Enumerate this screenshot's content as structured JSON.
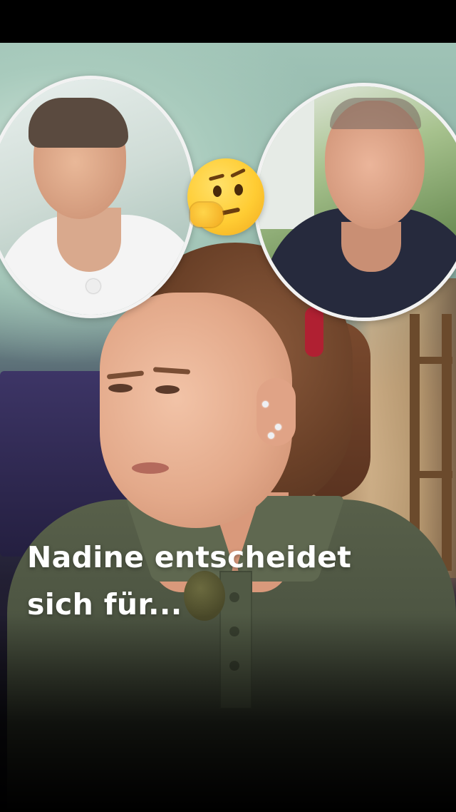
{
  "caption": {
    "line1": "Nadine entscheidet",
    "line2": "sich für..."
  },
  "overlays": {
    "left_portrait": "man-in-white-tshirt",
    "right_portrait": "man-in-navy-pullover",
    "emoji": "thinking-face-icon"
  },
  "colors": {
    "caption_text": "#ffffff",
    "circle_border": "#f2f2f2",
    "letterbox": "#000000"
  }
}
